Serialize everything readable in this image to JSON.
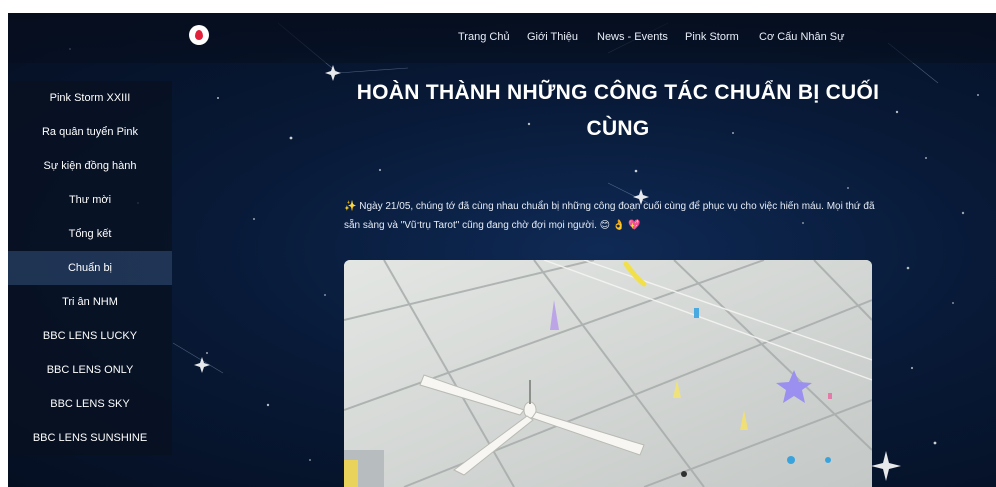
{
  "nav": {
    "items": [
      "Trang Chủ",
      "Giới Thiệu",
      "News - Events",
      "Pink Storm",
      "Cơ Cấu Nhân Sự"
    ]
  },
  "sidebar": {
    "items": [
      {
        "label": "Pink Storm XXIII"
      },
      {
        "label": "Ra quân tuyển Pink"
      },
      {
        "label": "Sự kiện đồng hành"
      },
      {
        "label": "Thư mời"
      },
      {
        "label": "Tổng kết"
      },
      {
        "label": "Chuẩn bị"
      },
      {
        "label": "Tri ân NHM"
      },
      {
        "label": "BBC LENS LUCKY"
      },
      {
        "label": "BBC LENS ONLY"
      },
      {
        "label": "BBC LENS SKY"
      },
      {
        "label": "BBC LENS SUNSHINE"
      }
    ],
    "active_index": 5
  },
  "article": {
    "title_line1": "HOÀN THÀNH NHỮNG CÔNG TÁC CHUẨN BỊ CUỐI",
    "title_line2": "CÙNG",
    "intro_icon": "✨",
    "intro_text": " Ngày 21/05, chúng tớ đã cùng nhau chuẩn bị những công đoạn cuối cùng để phục vụ cho việc hiến máu. Mọi thứ đã sẵn sàng và \"Vũ trụ Tarot\" cũng đang chờ đợi mọi người.",
    "intro_emojis": "😊 👌 💖"
  },
  "colors": {
    "background": "#081a38",
    "logo_drop": "#e2213a",
    "text": "#ffffff"
  },
  "icons": {
    "logo": "blood-drop-logo-icon"
  }
}
